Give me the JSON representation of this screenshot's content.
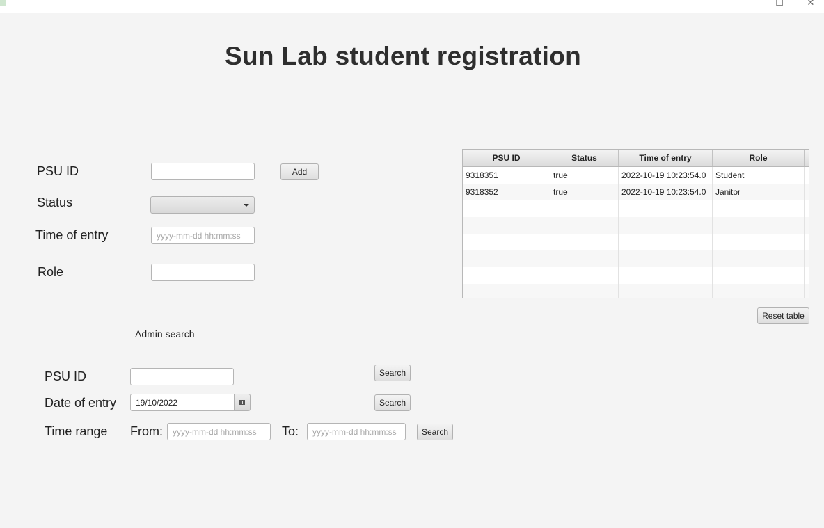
{
  "window": {
    "minimize_glyph": "—",
    "maximize_glyph": "☐",
    "close_glyph": "✕"
  },
  "title": "Sun Lab student registration",
  "form": {
    "psu_id_label": "PSU ID",
    "psu_id_value": "",
    "status_label": "Status",
    "status_value": "",
    "time_label": "Time of entry",
    "time_placeholder": "yyyy-mm-dd hh:mm:ss",
    "role_label": "Role",
    "role_value": "",
    "add_label": "Add"
  },
  "table": {
    "columns": [
      "PSU ID",
      "Status",
      "Time of entry",
      "Role"
    ],
    "rows": [
      [
        "9318351",
        "true",
        "2022-10-19 10:23:54.0",
        "Student"
      ],
      [
        "9318352",
        "true",
        "2022-10-19 10:23:54.0",
        "Janitor"
      ]
    ],
    "reset_label": "Reset table"
  },
  "admin": {
    "heading": "Admin search",
    "psu_id_label": "PSU ID",
    "date_label": "Date of entry",
    "date_value": "19/10/2022",
    "range_label": "Time range",
    "from_label": "From:",
    "to_label": "To:",
    "from_placeholder": "yyyy-mm-dd hh:mm:ss",
    "to_placeholder": "yyyy-mm-dd hh:mm:ss",
    "search_label": "Search"
  }
}
